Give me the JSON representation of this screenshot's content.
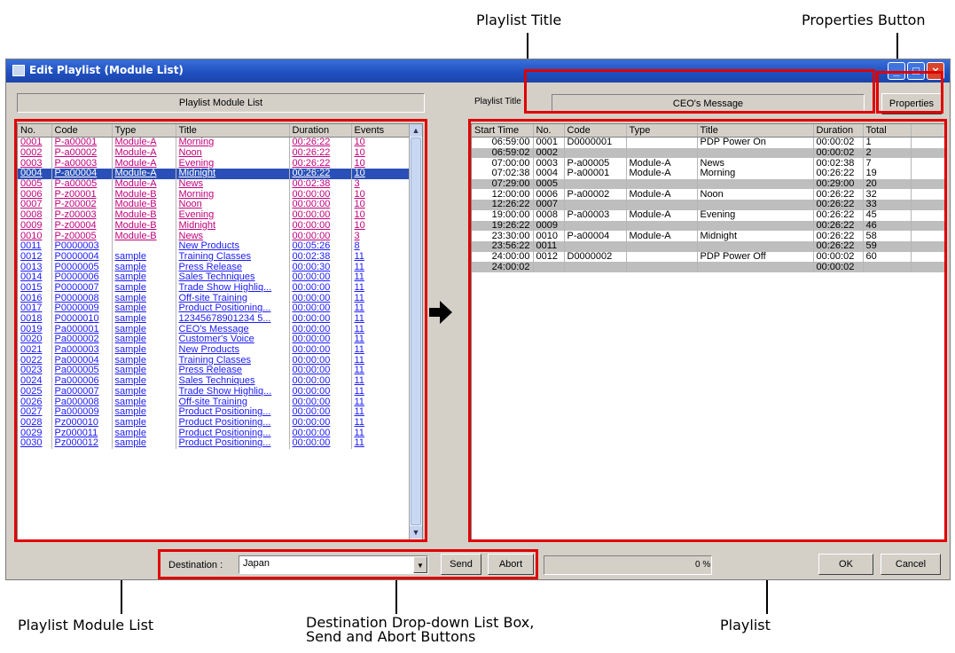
{
  "annotations": {
    "playlist_title": "Playlist Title",
    "properties_button": "Properties Button",
    "module_list": "Playlist Module List",
    "destination_line1": "Destination Drop-down List Box,",
    "destination_line2": "Send and Abort Buttons",
    "playlist": "Playlist"
  },
  "window": {
    "title": "Edit Playlist (Module List)"
  },
  "left_panel": {
    "header": "Playlist Module List",
    "columns": [
      "No.",
      "Code",
      "Type",
      "Title",
      "Duration",
      "Events"
    ],
    "rows": [
      {
        "no": "0001",
        "code": "P-a00001",
        "type": "Module-A",
        "title": "Morning",
        "duration": "00:26:22",
        "events": "10",
        "style": "pink"
      },
      {
        "no": "0002",
        "code": "P-a00002",
        "type": "Module-A",
        "title": "Noon",
        "duration": "00:26:22",
        "events": "10",
        "style": "pink"
      },
      {
        "no": "0003",
        "code": "P-a00003",
        "type": "Module-A",
        "title": "Evening",
        "duration": "00:26:22",
        "events": "10",
        "style": "pink"
      },
      {
        "no": "0004",
        "code": "P-a00004",
        "type": "Module-A",
        "title": "Midnight",
        "duration": "00:26:22",
        "events": "10",
        "style": "sel"
      },
      {
        "no": "0005",
        "code": "P-a00005",
        "type": "Module-A",
        "title": "News",
        "duration": "00:02:38",
        "events": "3",
        "style": "pink"
      },
      {
        "no": "0006",
        "code": "P-z00001",
        "type": "Module-B",
        "title": "Morning",
        "duration": "00:00:00",
        "events": "10",
        "style": "pink"
      },
      {
        "no": "0007",
        "code": "P-z00002",
        "type": "Module-B",
        "title": "Noon",
        "duration": "00:00:00",
        "events": "10",
        "style": "pink"
      },
      {
        "no": "0008",
        "code": "P-z00003",
        "type": "Module-B",
        "title": "Evening",
        "duration": "00:00:00",
        "events": "10",
        "style": "pink"
      },
      {
        "no": "0009",
        "code": "P-z00004",
        "type": "Module-B",
        "title": "Midnight",
        "duration": "00:00:00",
        "events": "10",
        "style": "pink"
      },
      {
        "no": "0010",
        "code": "P-z00005",
        "type": "Module-B",
        "title": "News",
        "duration": "00:00:00",
        "events": "3",
        "style": "pink"
      },
      {
        "no": "0011",
        "code": "P0000003",
        "type": "",
        "title": "New Products",
        "duration": "00:05:26",
        "events": "8",
        "style": "blue"
      },
      {
        "no": "0012",
        "code": "P0000004",
        "type": "sample",
        "title": "Training Classes",
        "duration": "00:02:38",
        "events": "11",
        "style": "blue"
      },
      {
        "no": "0013",
        "code": "P0000005",
        "type": "sample",
        "title": "Press Release",
        "duration": "00:00:30",
        "events": "11",
        "style": "blue"
      },
      {
        "no": "0014",
        "code": "P0000006",
        "type": "sample",
        "title": "Sales Techniques",
        "duration": "00:00:00",
        "events": "11",
        "style": "blue"
      },
      {
        "no": "0015",
        "code": "P0000007",
        "type": "sample",
        "title": "Trade Show Highliq...",
        "duration": "00:00:00",
        "events": "11",
        "style": "blue"
      },
      {
        "no": "0016",
        "code": "P0000008",
        "type": "sample",
        "title": "Off-site Training",
        "duration": "00:00:00",
        "events": "11",
        "style": "blue"
      },
      {
        "no": "0017",
        "code": "P0000009",
        "type": "sample",
        "title": "Product Positioning...",
        "duration": "00:00:00",
        "events": "11",
        "style": "blue"
      },
      {
        "no": "0018",
        "code": "P0000010",
        "type": "sample",
        "title": "12345678901234 5...",
        "duration": "00:00:00",
        "events": "11",
        "style": "blue"
      },
      {
        "no": "0019",
        "code": "Pa000001",
        "type": "sample",
        "title": "CEO's Message",
        "duration": "00:00:00",
        "events": "11",
        "style": "blue"
      },
      {
        "no": "0020",
        "code": "Pa000002",
        "type": "sample",
        "title": "Customer's Voice",
        "duration": "00:00:00",
        "events": "11",
        "style": "blue"
      },
      {
        "no": "0021",
        "code": "Pa000003",
        "type": "sample",
        "title": "New Products",
        "duration": "00:00:00",
        "events": "11",
        "style": "blue"
      },
      {
        "no": "0022",
        "code": "Pa000004",
        "type": "sample",
        "title": "Training Classes",
        "duration": "00:00:00",
        "events": "11",
        "style": "blue"
      },
      {
        "no": "0023",
        "code": "Pa000005",
        "type": "sample",
        "title": "Press Release",
        "duration": "00:00:00",
        "events": "11",
        "style": "blue"
      },
      {
        "no": "0024",
        "code": "Pa000006",
        "type": "sample",
        "title": "Sales Techniques",
        "duration": "00:00:00",
        "events": "11",
        "style": "blue"
      },
      {
        "no": "0025",
        "code": "Pa000007",
        "type": "sample",
        "title": "Trade Show Highliq...",
        "duration": "00:00:00",
        "events": "11",
        "style": "blue"
      },
      {
        "no": "0026",
        "code": "Pa000008",
        "type": "sample",
        "title": "Off-site Training",
        "duration": "00:00:00",
        "events": "11",
        "style": "blue"
      },
      {
        "no": "0027",
        "code": "Pa000009",
        "type": "sample",
        "title": "Product Positioning...",
        "duration": "00:00:00",
        "events": "11",
        "style": "blue"
      },
      {
        "no": "0028",
        "code": "Pz000010",
        "type": "sample",
        "title": "Product Positioning...",
        "duration": "00:00:00",
        "events": "11",
        "style": "blue"
      },
      {
        "no": "0029",
        "code": "Pz000011",
        "type": "sample",
        "title": "Product Positioning...",
        "duration": "00:00:00",
        "events": "11",
        "style": "blue"
      },
      {
        "no": "0030",
        "code": "Pz000012",
        "type": "sample",
        "title": "Product Positioning...",
        "duration": "00:00:00",
        "events": "11",
        "style": "blue"
      }
    ]
  },
  "right_panel": {
    "playlist_title_label": "Playlist Title :",
    "playlist_title_value": "CEO's Message",
    "properties_label": "Properties",
    "columns": [
      "Start Time",
      "No.",
      "Code",
      "Type",
      "Title",
      "Duration",
      "Total"
    ],
    "rows": [
      {
        "start": "06:59:00",
        "no": "0001",
        "code": "D0000001",
        "type": "",
        "title": "PDP Power On",
        "duration": "00:00:02",
        "total": "1",
        "gray": false
      },
      {
        "start": "06:59:02",
        "no": "0002",
        "code": "",
        "type": "",
        "title": "",
        "duration": "00:00:02",
        "total": "2",
        "gray": true
      },
      {
        "start": "07:00:00",
        "no": "0003",
        "code": "P-a00005",
        "type": "Module-A",
        "title": "News",
        "duration": "00:02:38",
        "total": "7",
        "gray": false
      },
      {
        "start": "07:02:38",
        "no": "0004",
        "code": "P-a00001",
        "type": "Module-A",
        "title": "Morning",
        "duration": "00:26:22",
        "total": "19",
        "gray": false
      },
      {
        "start": "07:29:00",
        "no": "0005",
        "code": "",
        "type": "",
        "title": "",
        "duration": "00:29:00",
        "total": "20",
        "gray": true
      },
      {
        "start": "12:00:00",
        "no": "0006",
        "code": "P-a00002",
        "type": "Module-A",
        "title": "Noon",
        "duration": "00:26:22",
        "total": "32",
        "gray": false
      },
      {
        "start": "12:26:22",
        "no": "0007",
        "code": "",
        "type": "",
        "title": "",
        "duration": "00:26:22",
        "total": "33",
        "gray": true
      },
      {
        "start": "19:00:00",
        "no": "0008",
        "code": "P-a00003",
        "type": "Module-A",
        "title": "Evening",
        "duration": "00:26:22",
        "total": "45",
        "gray": false
      },
      {
        "start": "19:26:22",
        "no": "0009",
        "code": "",
        "type": "",
        "title": "",
        "duration": "00:26:22",
        "total": "46",
        "gray": true
      },
      {
        "start": "23:30:00",
        "no": "0010",
        "code": "P-a00004",
        "type": "Module-A",
        "title": "Midnight",
        "duration": "00:26:22",
        "total": "58",
        "gray": false
      },
      {
        "start": "23:56:22",
        "no": "0011",
        "code": "",
        "type": "",
        "title": "",
        "duration": "00:26:22",
        "total": "59",
        "gray": true
      },
      {
        "start": "24:00:00",
        "no": "0012",
        "code": "D0000002",
        "type": "",
        "title": "PDP Power Off",
        "duration": "00:00:02",
        "total": "60",
        "gray": false
      },
      {
        "start": "24:00:02",
        "no": "",
        "code": "",
        "type": "",
        "title": "",
        "duration": "00:00:02",
        "total": "",
        "gray": true
      }
    ]
  },
  "bottom": {
    "destination_label": "Destination :",
    "destination_value": "Japan",
    "send_label": "Send",
    "abort_label": "Abort",
    "progress_text": "0 %",
    "progress_fraction": 0,
    "ok_label": "OK",
    "cancel_label": "Cancel"
  }
}
